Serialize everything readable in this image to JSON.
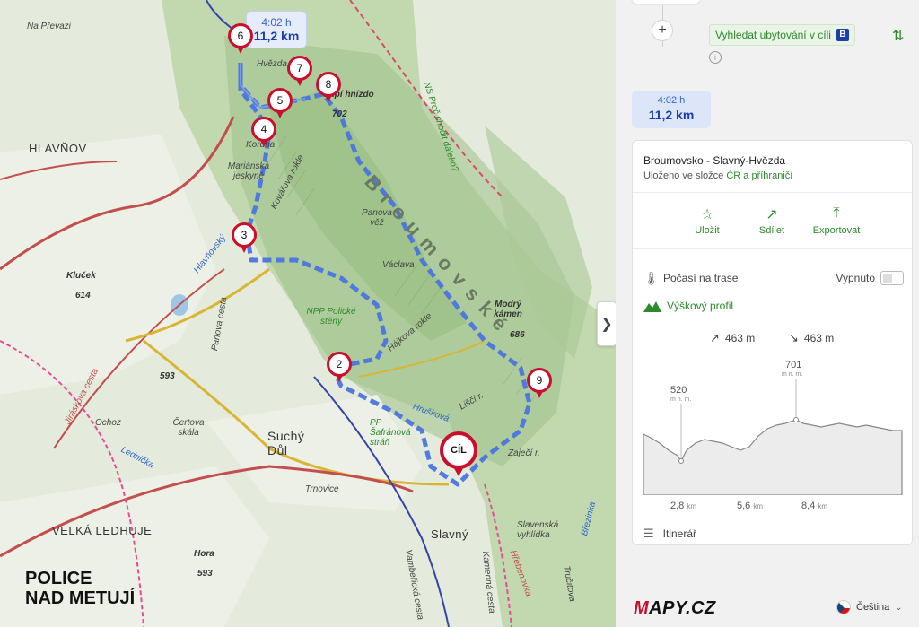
{
  "map": {
    "route_time": "4:02 h",
    "route_distance": "11,2 km",
    "markers": [
      "6",
      "7",
      "8",
      "5",
      "4",
      "3",
      "2",
      "9"
    ],
    "finish_marker": "CÍL",
    "labels": {
      "na_prevazi": "Na Převazi",
      "hlavnov": "HLAVŇOV",
      "hvezda": "Hvězda",
      "supi_hnizdo": "Supí hnízdo",
      "supi_alt": "702",
      "koruna": "Koruna",
      "marianska": "Mariánská jeskyně",
      "kovarova": "Kovářova rokle",
      "broumovske": "B r o u m o v s k é",
      "panova_vez": "Panova věž",
      "vaclava": "Václava",
      "klucek": "Kluček",
      "klucek_alt": "614",
      "npp_policke": "NPP Polické stěny",
      "modry_kamen": "Modrý kámen",
      "modry_alt": "686",
      "hajkova": "Hájkova rokle",
      "alt_593": "593",
      "jiraskova": "Jiráskova cesta",
      "ochoz": "Ochoz",
      "certova": "Čertova skála",
      "lednicka": "Lednička",
      "hruskova": "Hrušková",
      "lisci": "Liščí r.",
      "pp_safranova": "PP Šafránová stráň",
      "sucha_dul": "Suchý Důl",
      "trnovice": "Trnovice",
      "zajeci": "Zaječí r.",
      "velka_ledhuje": "VELKÁ LEDHUJE",
      "police": "POLICE",
      "nad_metuji": "NAD METUJÍ",
      "hora": "Hora",
      "hora_alt": "593",
      "slavny": "Slavný",
      "slavenska": "Slavenská vyhlídka",
      "hrebenovka": "Hřebenovka",
      "trcisitova": "Tručitova",
      "ns_proc": "NS Proč chodit daleko?",
      "panova_cesta": "Panova cesta",
      "hlavnovsky": "Hlavňovský",
      "vambericka": "Vambeřická cesta",
      "kamenna": "Kamenná cesta",
      "brezinka": "Březinka"
    }
  },
  "panel": {
    "accommodation_label": "Vyhledat ubytování v cíli",
    "booking_badge": "B",
    "summary_time": "4:02 h",
    "summary_distance": "11,2 km",
    "route_title": "Broumovsko - Slavný-Hvězda",
    "folder_prefix": "Uloženo ve složce",
    "folder_name": "ČR a příhraničí",
    "actions": [
      {
        "label": "Uložit",
        "icon": "star-icon"
      },
      {
        "label": "Sdílet",
        "icon": "share-icon"
      },
      {
        "label": "Exportovat",
        "icon": "export-icon"
      }
    ],
    "weather_label": "Počasí na trase",
    "weather_state": "Vypnuto",
    "profile_label": "Výškový profil",
    "ascent": "463 m",
    "descent": "463 m",
    "profile_min": "520",
    "profile_max": "701",
    "profile_unit": "m n. m.",
    "km_ticks": [
      {
        "value": "2,8",
        "unit": "km"
      },
      {
        "value": "5,6",
        "unit": "km"
      },
      {
        "value": "8,4",
        "unit": "km"
      }
    ],
    "itinerary_label": "Itinerář",
    "logo": "MAPY.CZ",
    "language": "Čeština"
  },
  "colors": {
    "route": "#4a74e0",
    "marker": "#c8102e",
    "accent_green": "#2d8a2d",
    "blue_dark": "#1b3fa6"
  }
}
